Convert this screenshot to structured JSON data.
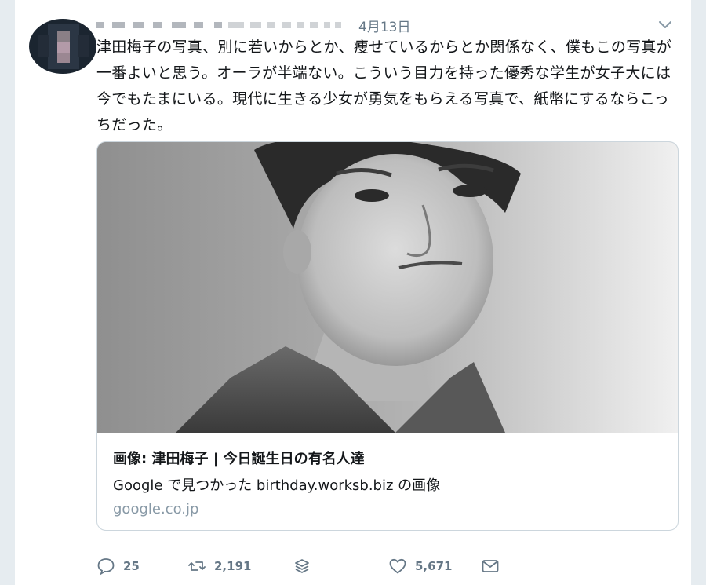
{
  "header": {
    "timestamp": "4月13日"
  },
  "tweet": {
    "text": "津田梅子の写真、別に若いからとか、痩せているからとか関係なく、僕もこの写真が一番よいと思う。オーラが半端ない。こういう目力を持った優秀な学生が女子大には今でもたまにいる。現代に生きる少女が勇気をもらえる写真で、紙幣にするならこっちだった。"
  },
  "link_card": {
    "title": "画像: 津田梅子 | 今日誕生日の有名人達",
    "description": "Google で見つかった birthday.worksb.biz の画像",
    "domain": "google.co.jp"
  },
  "actions": {
    "reply_count": "25",
    "retweet_count": "2,191",
    "like_count": "5,671"
  },
  "icons": {
    "reply": "reply-icon",
    "retweet": "retweet-icon",
    "stack": "stack-icon",
    "like": "heart-icon",
    "dm": "envelope-icon",
    "caret": "chevron-down-icon"
  },
  "colors": {
    "text": "#14171a",
    "secondary": "#657786",
    "border": "#ccd6dd",
    "background": "#e6ecf0"
  }
}
